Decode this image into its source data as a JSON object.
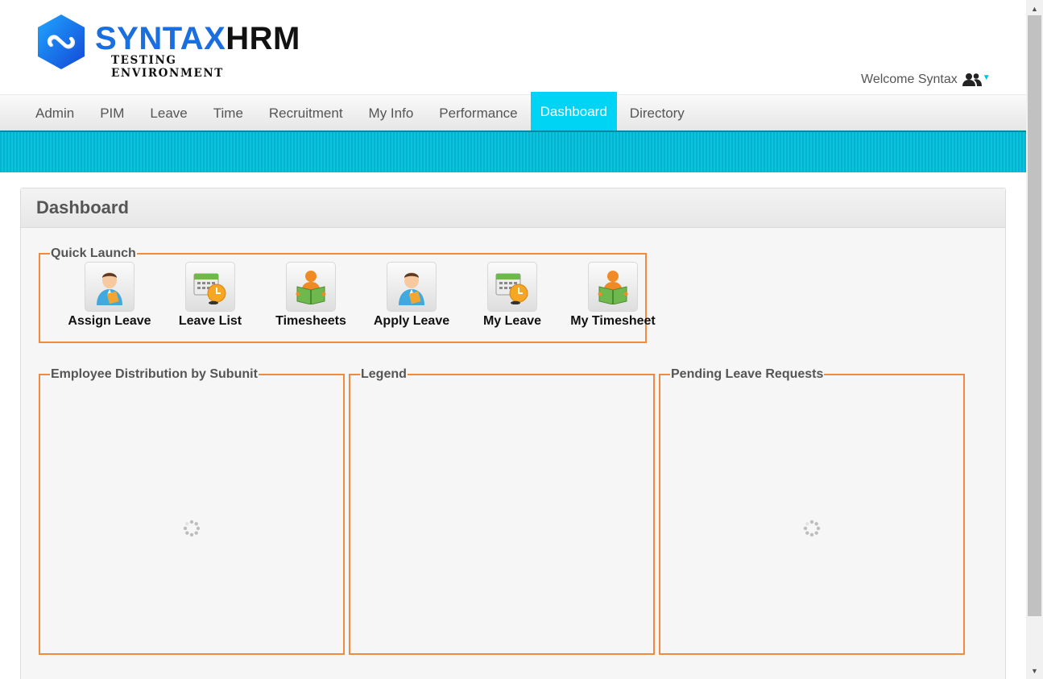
{
  "header": {
    "logo": {
      "brand_part1": "SYNTAX",
      "brand_part2": "HRM",
      "subtitle": "TESTING ENVIRONMENT"
    },
    "welcome_text": "Welcome Syntax",
    "user_menu_icon": "users-icon"
  },
  "nav": {
    "items": [
      {
        "label": "Admin"
      },
      {
        "label": "PIM"
      },
      {
        "label": "Leave"
      },
      {
        "label": "Time"
      },
      {
        "label": "Recruitment"
      },
      {
        "label": "My Info"
      },
      {
        "label": "Performance"
      },
      {
        "label": "Dashboard",
        "active": true
      },
      {
        "label": "Directory"
      }
    ],
    "active_color": "#00d4f5"
  },
  "dashboard": {
    "title": "Dashboard",
    "quick_launch": {
      "legend": "Quick Launch",
      "items": [
        {
          "label": "Assign Leave",
          "icon": "person-document-icon"
        },
        {
          "label": "Leave List",
          "icon": "calendar-clock-icon"
        },
        {
          "label": "Timesheets",
          "icon": "person-book-icon"
        },
        {
          "label": "Apply Leave",
          "icon": "person-document-icon"
        },
        {
          "label": "My Leave",
          "icon": "calendar-clock-icon"
        },
        {
          "label": "My Timesheet",
          "icon": "person-book-icon"
        }
      ]
    },
    "widgets": {
      "distribution_legend": "Employee Distribution by Subunit",
      "legend_legend": "Legend",
      "pending_legend": "Pending Leave Requests"
    },
    "accent_color": "#f08a3c"
  }
}
